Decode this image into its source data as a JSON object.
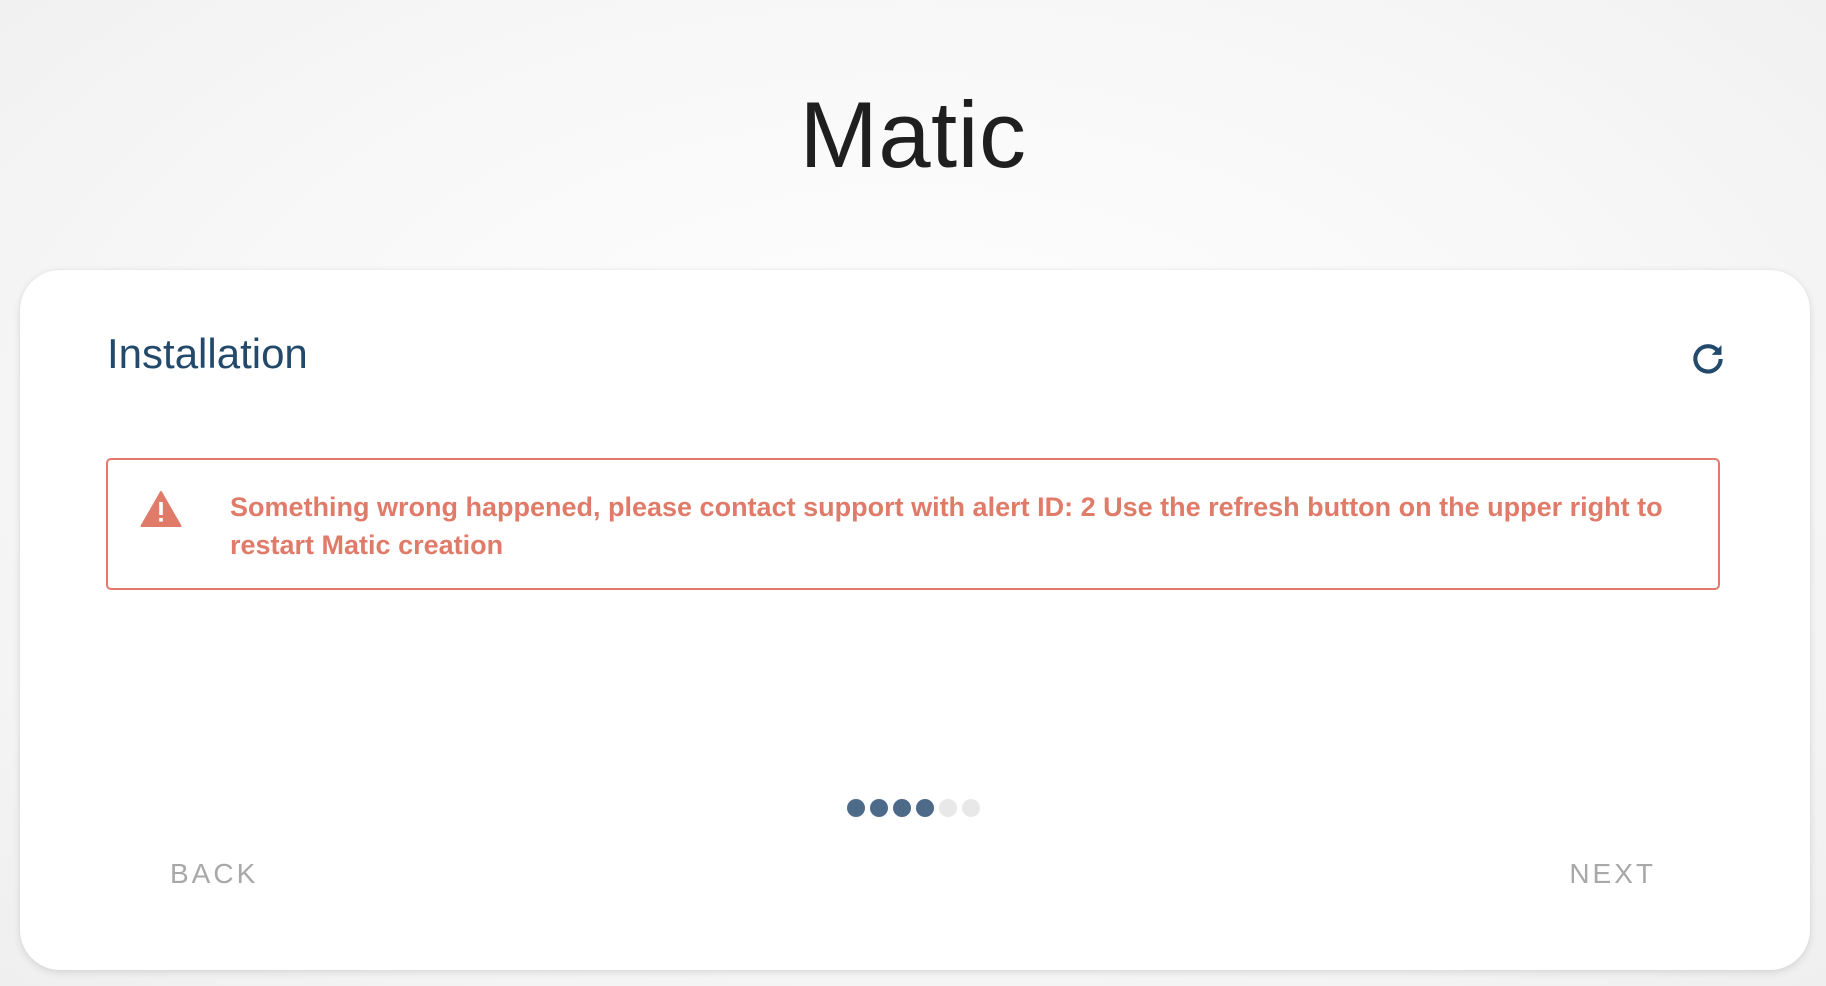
{
  "app": {
    "title": "Matic"
  },
  "card": {
    "title": "Installation",
    "refresh_icon": "refresh-icon"
  },
  "alert": {
    "icon": "warning-triangle-icon",
    "message": "Something wrong happened, please contact support with alert ID: 2 Use the refresh button on the upper right to restart Matic creation"
  },
  "stepper": {
    "total_steps": 6,
    "current_step": 4
  },
  "navigation": {
    "back_label": "BACK",
    "next_label": "NEXT"
  },
  "colors": {
    "accent": "#234a6a",
    "step_active": "#4d6b89",
    "step_inactive": "#e8e8e8",
    "error": "#e07b6a",
    "disabled_text": "#a8a8a8"
  }
}
